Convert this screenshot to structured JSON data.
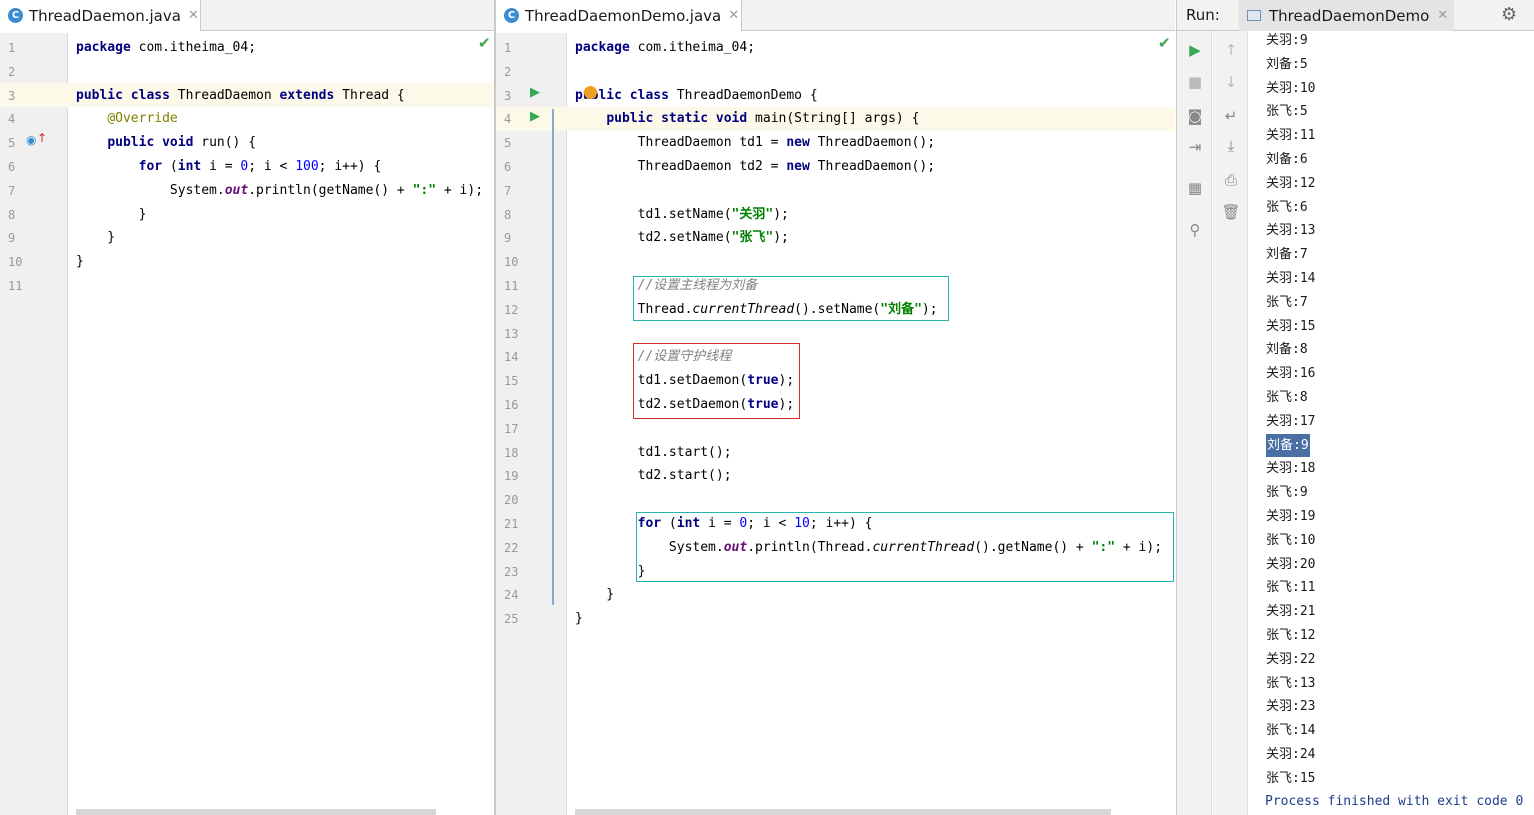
{
  "left_tab": {
    "label": "ThreadDaemon.java",
    "icon": "c-class-icon"
  },
  "right_tab": {
    "label": "ThreadDaemonDemo.java",
    "icon": "c-class-icon"
  },
  "left_editor": {
    "lines": [
      "package com.itheima_04;",
      "",
      "public class ThreadDaemon extends Thread {",
      "    @Override",
      "    public void run() {",
      "        for (int i = 0; i < 100; i++) {",
      "            System.out.println(getName() + \":\" + i);",
      "        }",
      "    }",
      "}",
      ""
    ]
  },
  "right_editor": {
    "lines": [
      "package com.itheima_04;",
      "",
      "public class ThreadDaemonDemo {",
      "    public static void main(String[] args) {",
      "        ThreadDaemon td1 = new ThreadDaemon();",
      "        ThreadDaemon td2 = new ThreadDaemon();",
      "",
      "        td1.setName(\"关羽\");",
      "        td2.setName(\"张飞\");",
      "",
      "        //设置主线程为刘备",
      "        Thread.currentThread().setName(\"刘备\");",
      "",
      "        //设置守护线程",
      "        td1.setDaemon(true);",
      "        td2.setDaemon(true);",
      "",
      "        td1.start();",
      "        td2.start();",
      "",
      "        for (int i = 0; i < 10; i++) {",
      "            System.out.println(Thread.currentThread().getName() + \":\" + i);",
      "        }",
      "    }",
      "}"
    ]
  },
  "run_panel": {
    "label": "Run:",
    "tab_label": "ThreadDaemonDemo",
    "output": [
      "关羽:9",
      "刘备:5",
      "关羽:10",
      "张飞:5",
      "关羽:11",
      "刘备:6",
      "关羽:12",
      "张飞:6",
      "关羽:13",
      "刘备:7",
      "关羽:14",
      "张飞:7",
      "关羽:15",
      "刘备:8",
      "关羽:16",
      "张飞:8",
      "关羽:17",
      "刘备:9",
      "关羽:18",
      "张飞:9",
      "关羽:19",
      "张飞:10",
      "关羽:20",
      "张飞:11",
      "关羽:21",
      "张飞:12",
      "关羽:22",
      "张飞:13",
      "关羽:23",
      "张飞:14",
      "关羽:24",
      "张飞:15"
    ],
    "selected_output": "刘备:9",
    "finish_message": "Process finished with exit code 0"
  },
  "colors": {
    "keyword": "#000080",
    "string": "#008000",
    "number": "#0000ff",
    "comment": "#808080",
    "annotation": "#808000",
    "cyan_box": "#26b5b0",
    "red_box": "#d03030",
    "selection": "#4a6fa5"
  }
}
